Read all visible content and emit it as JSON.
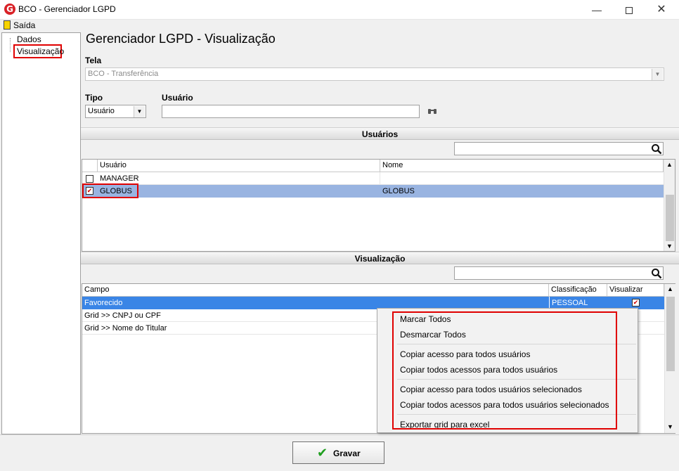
{
  "window": {
    "title": "BCO - Gerenciador LGPD",
    "app_icon_letter": "G"
  },
  "menu": {
    "exit_label": "Saída"
  },
  "tree": {
    "items": [
      "Dados",
      "Visualização"
    ]
  },
  "main": {
    "title": "Gerenciador LGPD - Visualização",
    "tela_label": "Tela",
    "tela_value": "BCO - Transferência",
    "tipo_label": "Tipo",
    "tipo_value": "Usuário",
    "usuario_label": "Usuário",
    "usuario_value": ""
  },
  "users_section": {
    "header": "Usuários",
    "search_value": "",
    "columns": [
      "Usuário",
      "Nome"
    ],
    "rows": [
      {
        "usuario": "MANAGER",
        "nome": "",
        "checked": false
      },
      {
        "usuario": "GLOBUS",
        "nome": "GLOBUS",
        "checked": true
      }
    ]
  },
  "view_section": {
    "header": "Visualização",
    "search_value": "",
    "columns": [
      "Campo",
      "Classificação",
      "Visualizar"
    ],
    "rows": [
      {
        "campo": "Favorecido",
        "classificacao": "PESSOAL",
        "visualizar": true
      },
      {
        "campo": "Grid >> CNPJ ou CPF",
        "classificacao": "",
        "visualizar": false
      },
      {
        "campo": "Grid >> Nome do Titular",
        "classificacao": "",
        "visualizar": false
      }
    ]
  },
  "context_menu": {
    "items": [
      "Marcar Todos",
      "Desmarcar Todos",
      "Copiar acesso para todos usuários",
      "Copiar todos acessos para todos usuários",
      "Copiar acesso para todos usuários selecionados",
      "Copiar todos acessos para todos usuários selecionados",
      "Exportar grid para excel"
    ]
  },
  "footer": {
    "save_label": "Gravar"
  },
  "colors": {
    "highlight_red": "#e00000",
    "row_selected": "#99b4e1",
    "row_selected_blue": "#3a85e6"
  }
}
